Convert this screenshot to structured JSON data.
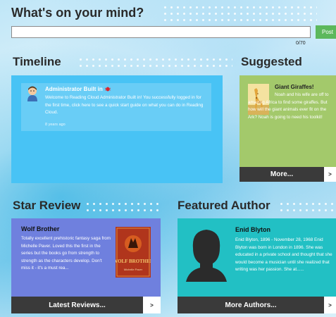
{
  "composer": {
    "title": "What's on your mind?",
    "input_value": "",
    "post_label": "Post",
    "char_count": "0/70"
  },
  "timeline": {
    "title": "Timeline",
    "post": {
      "author": "Administrator Built in",
      "author_badge_icon": "red-bug-icon",
      "text": "Welcome to Reading Cloud Administrator Built in! You successfully logged in for the first time, click here to see a quick start guide on what you can do in Reading Cloud.",
      "time": "8 years ago"
    }
  },
  "suggested": {
    "title": "Suggested",
    "book_title": "Giant Giraffes!",
    "text": "Noah and his wife are off to amazing Africa to find some giraffes. But how will the giant animals ever fit on the Ark? Noah is going to need his toolkit!",
    "more_label": "More...",
    "arrow": ">"
  },
  "star_review": {
    "title": "Star Review",
    "book_title": "Wolf Brother",
    "text": "Totally excellent prehistoric fantasy saga from Michelle Paver. Loved this the first in the series but the books go from strength to strength as the characters develop. Don't miss it - it's a must rea...",
    "cover_title": "WOLF BROTHER",
    "cover_author": "Michelle Paver",
    "button_label": "Latest Reviews...",
    "arrow": ">"
  },
  "featured_author": {
    "title": "Featured Author",
    "name": "Enid Blyton",
    "text": "Enid Blyton, 1896 - November 28, 1968 Enid Blyton was born in London in 1896. She was educated in a private school and thought that she would become a musician until she realized that writing was her passion. She at......",
    "button_label": "More Authors...",
    "arrow": ">"
  },
  "colors": {
    "timeline": "#48c3f5",
    "suggested": "#a3c96b",
    "star_review": "#6f80de",
    "featured_author": "#22c0c4",
    "button_bar": "#3a3a3a",
    "post_button": "#5cb85c"
  }
}
